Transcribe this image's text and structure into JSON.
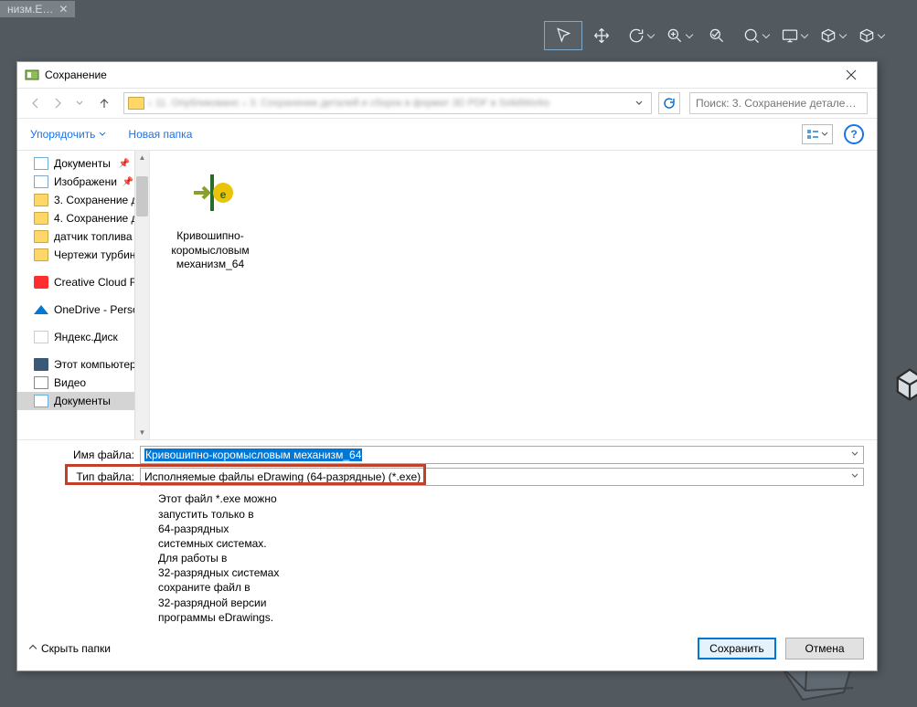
{
  "app_tab": {
    "label": "низм.Е…"
  },
  "dialog": {
    "title": "Сохранение",
    "close_glyph": "✕",
    "search_placeholder": "Поиск: 3. Сохранение детале…",
    "breadcrumb": {
      "seg1": "11. Опубликовано",
      "seg2": "3. Сохранение деталей и сборок в формат 3D PDF в SolidWorks"
    }
  },
  "toolbar": {
    "organize": "Упорядочить",
    "new_folder": "Новая папка"
  },
  "sidebar": {
    "items": [
      {
        "icon": "doc",
        "label": "Документы",
        "pinned": true
      },
      {
        "icon": "img",
        "label": "Изображени",
        "pinned": true
      },
      {
        "icon": "folder",
        "label": "3. Сохранение д"
      },
      {
        "icon": "folder",
        "label": "4. Сохранение д"
      },
      {
        "icon": "folder",
        "label": "датчик топлива"
      },
      {
        "icon": "folder",
        "label": "Чертежи турбин"
      },
      {
        "icon": "spacer"
      },
      {
        "icon": "cc",
        "label": "Creative Cloud Fil"
      },
      {
        "icon": "spacer"
      },
      {
        "icon": "od",
        "label": "OneDrive - Persor"
      },
      {
        "icon": "spacer"
      },
      {
        "icon": "yd",
        "label": "Яндекс.Диск"
      },
      {
        "icon": "spacer"
      },
      {
        "icon": "pc",
        "label": "Этот компьютер"
      },
      {
        "icon": "vid",
        "label": "Видео"
      },
      {
        "icon": "doc",
        "label": "Документы",
        "selected": true
      }
    ]
  },
  "file": {
    "name": "Кривошипно-коромысловым механизм_64"
  },
  "form": {
    "filename_label": "Имя файла:",
    "filename_value": "Кривошипно-коромысловым механизм_64",
    "filetype_label": "Тип файла:",
    "filetype_value": "Исполняемые файлы eDrawing (64-разрядные) (*.exe)"
  },
  "info_text_lines": [
    "Этот файл *.exe можно",
    "запустить только в",
    "64-разрядных",
    "системных системах.",
    "Для работы в",
    "32-разрядных системах",
    "сохраните файл в",
    "32-разрядной версии",
    "программы eDrawings."
  ],
  "buttons": {
    "hide_folders": "Скрыть папки",
    "save": "Сохранить",
    "cancel": "Отмена"
  },
  "help_label": "?"
}
